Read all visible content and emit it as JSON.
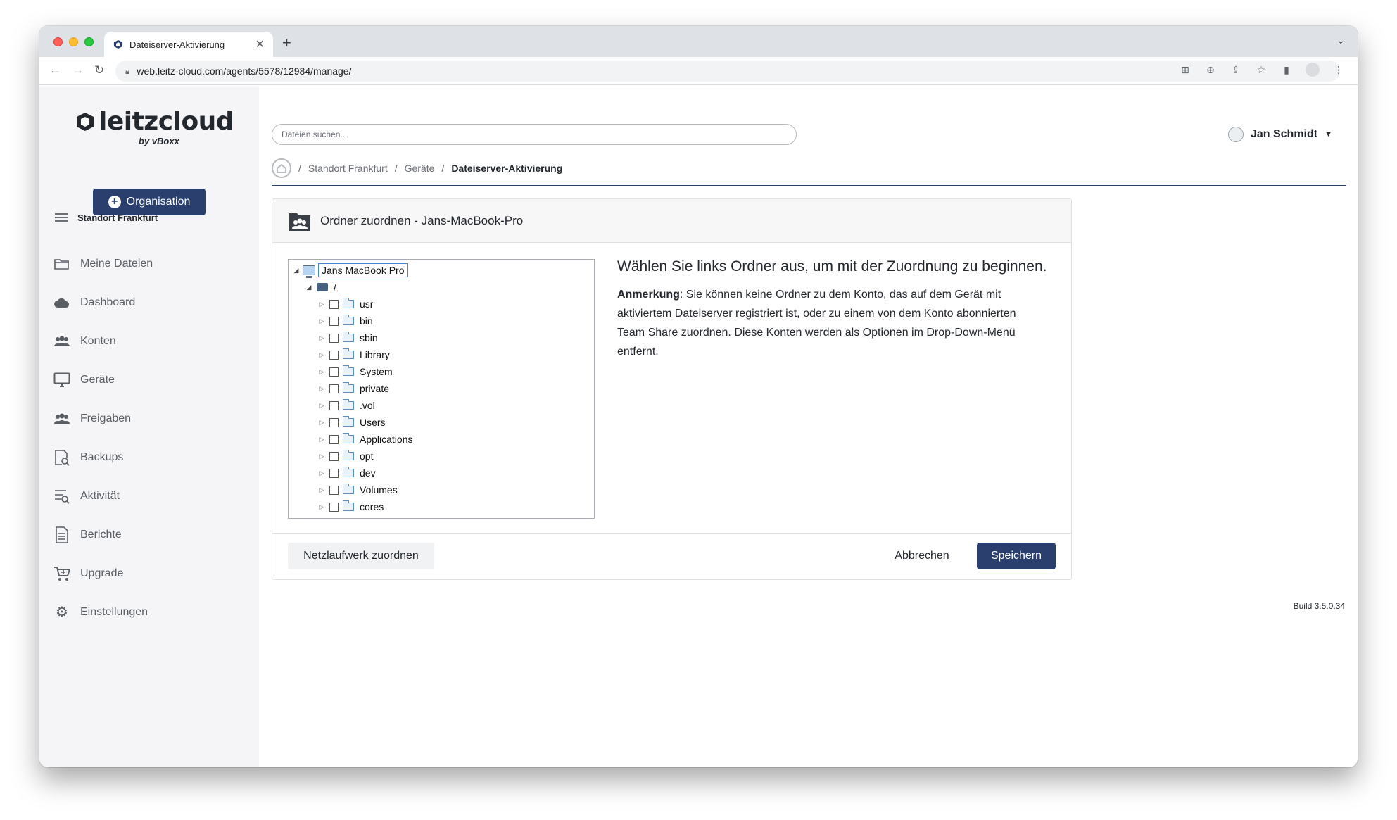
{
  "browser": {
    "tab_title": "Dateiserver-Aktivierung",
    "url": "web.leitz-cloud.com/agents/5578/12984/manage/"
  },
  "sidebar": {
    "logo_text": "leitzcloud",
    "logo_sub": "by vBoxx",
    "org_button": "Organisation",
    "location": "Standort Frankfurt",
    "items": [
      {
        "label": "Meine Dateien",
        "icon": "folder-icon"
      },
      {
        "label": "Dashboard",
        "icon": "cloud-icon"
      },
      {
        "label": "Konten",
        "icon": "users-icon"
      },
      {
        "label": "Geräte",
        "icon": "monitor-icon"
      },
      {
        "label": "Freigaben",
        "icon": "share-users-icon"
      },
      {
        "label": "Backups",
        "icon": "backup-icon"
      },
      {
        "label": "Aktivität",
        "icon": "activity-icon"
      },
      {
        "label": "Berichte",
        "icon": "report-icon"
      },
      {
        "label": "Upgrade",
        "icon": "cart-icon"
      },
      {
        "label": "Einstellungen",
        "icon": "gear-icon"
      }
    ]
  },
  "header": {
    "search_placeholder": "Dateien suchen...",
    "user_name": "Jan Schmidt"
  },
  "breadcrumb": {
    "items": [
      "Standort Frankfurt",
      "Geräte"
    ],
    "current": "Dateiserver-Aktivierung"
  },
  "card": {
    "title": "Ordner zuordnen - Jans-MacBook-Pro",
    "tree": {
      "root": "Jans MacBook Pro",
      "drive": "/",
      "folders": [
        "usr",
        "bin",
        "sbin",
        "Library",
        "System",
        "private",
        ".vol",
        "Users",
        "Applications",
        "opt",
        "dev",
        "Volumes",
        "cores"
      ]
    },
    "info_title": "Wählen Sie links Ordner aus, um mit der Zuordnung zu beginnen.",
    "note_label": "Anmerkung",
    "note_text": ": Sie können keine Ordner zu dem Konto, das auf dem Gerät mit aktiviertem Dateiserver registriert ist, oder zu einem von dem Konto abonnierten Team Share zuordnen. Diese Konten werden als Optionen im Drop-Down-Menü entfernt.",
    "btn_network": "Netzlaufwerk zuordnen",
    "btn_cancel": "Abbrechen",
    "btn_save": "Speichern"
  },
  "build": "Build 3.5.0.34",
  "colors": {
    "primary": "#2a3f6d",
    "sidebar_bg": "#f5f5f7"
  }
}
